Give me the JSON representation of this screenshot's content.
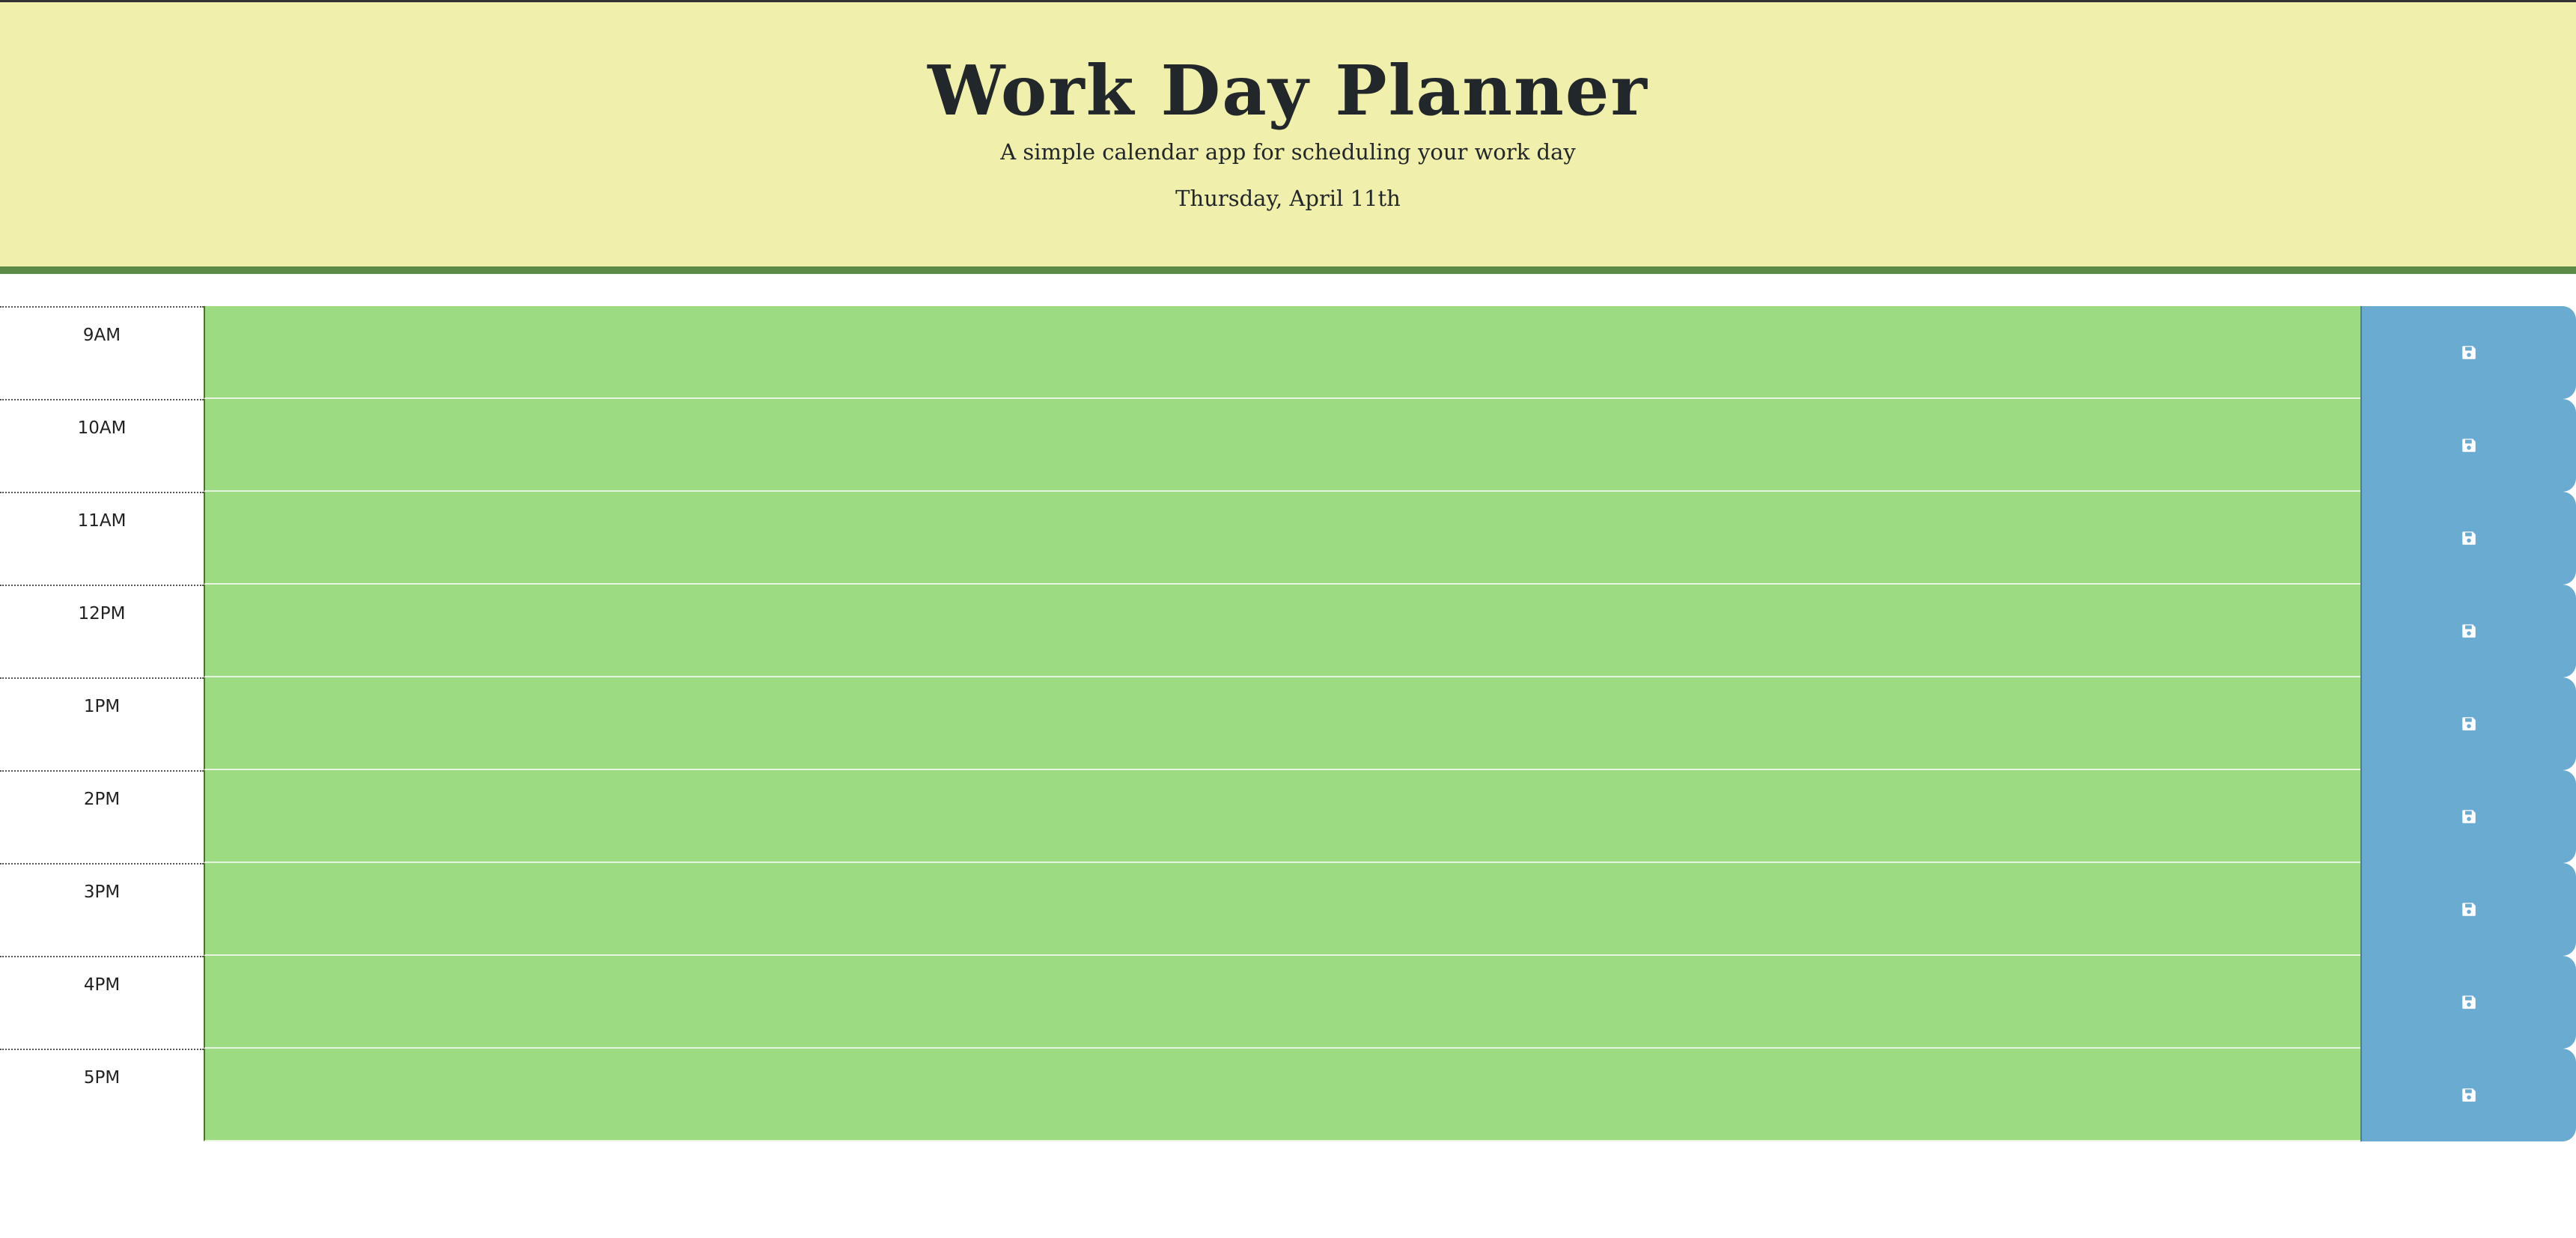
{
  "header": {
    "title": "Work Day Planner",
    "subtitle": "A simple calendar app for scheduling your work day",
    "current_day": "Thursday, April 11th"
  },
  "planner": {
    "hours": [
      {
        "label": "9AM",
        "text": ""
      },
      {
        "label": "10AM",
        "text": ""
      },
      {
        "label": "11AM",
        "text": ""
      },
      {
        "label": "12PM",
        "text": ""
      },
      {
        "label": "1PM",
        "text": ""
      },
      {
        "label": "2PM",
        "text": ""
      },
      {
        "label": "3PM",
        "text": ""
      },
      {
        "label": "4PM",
        "text": ""
      },
      {
        "label": "5PM",
        "text": ""
      }
    ],
    "save_icon": "floppy-disk-icon"
  },
  "colors": {
    "header_background": "#f0f0ac",
    "header_border": "#5b8a47",
    "future_block": "#9ddb82",
    "save_button": "#6aabd2"
  }
}
